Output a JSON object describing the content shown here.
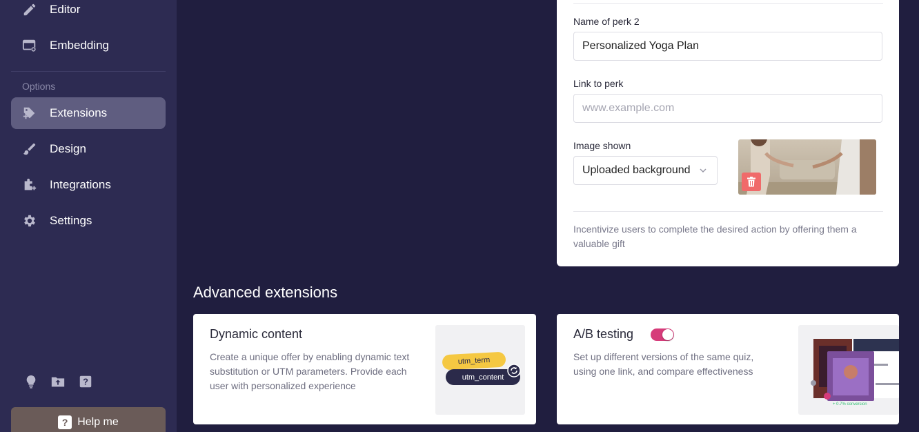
{
  "sidebar": {
    "items": [
      {
        "label": "Editor",
        "icon": "pencil-icon"
      },
      {
        "label": "Embedding",
        "icon": "embed-icon"
      },
      {
        "label": "Extensions",
        "icon": "extension-icon",
        "active": true
      },
      {
        "label": "Design",
        "icon": "brush-icon"
      },
      {
        "label": "Integrations",
        "icon": "integrations-icon"
      },
      {
        "label": "Settings",
        "icon": "gear-icon"
      }
    ],
    "options_label": "Options",
    "footer_icons": [
      "lightbulb-icon",
      "upload-folder-icon",
      "help-question-icon"
    ],
    "help_button": "Help me"
  },
  "perk": {
    "name_label": "Name of perk 2",
    "name_value": "Personalized Yoga Plan",
    "link_label": "Link to perk",
    "link_placeholder": "www.example.com",
    "image_label": "Image shown",
    "image_select": "Uploaded background",
    "description": "Incentivize users to complete the desired action by offering them a valuable gift"
  },
  "advanced": {
    "title": "Advanced extensions",
    "cards": [
      {
        "title": "Dynamic content",
        "description": "Create a unique offer by enabling dynamic text substitution or UTM parameters. Provide each user with personalized experience",
        "pills": [
          "utm_term",
          "utm_content"
        ]
      },
      {
        "title": "A/B testing",
        "description": "Set up different versions of the same quiz, using one link, and compare effectiveness",
        "toggle_on": true,
        "preview_caption": "+ 0.7% conversion"
      }
    ]
  },
  "colors": {
    "page_bg": "#201e3f",
    "sidebar_bg": "#2d2b52",
    "active_item_bg": "#5f5d80",
    "accent_pink": "#d63c7a",
    "delete_red": "#f06a6a",
    "help_bg": "#6a5b58",
    "utm_yellow": "#f5c842",
    "utm_dark": "#2b2a4a"
  }
}
